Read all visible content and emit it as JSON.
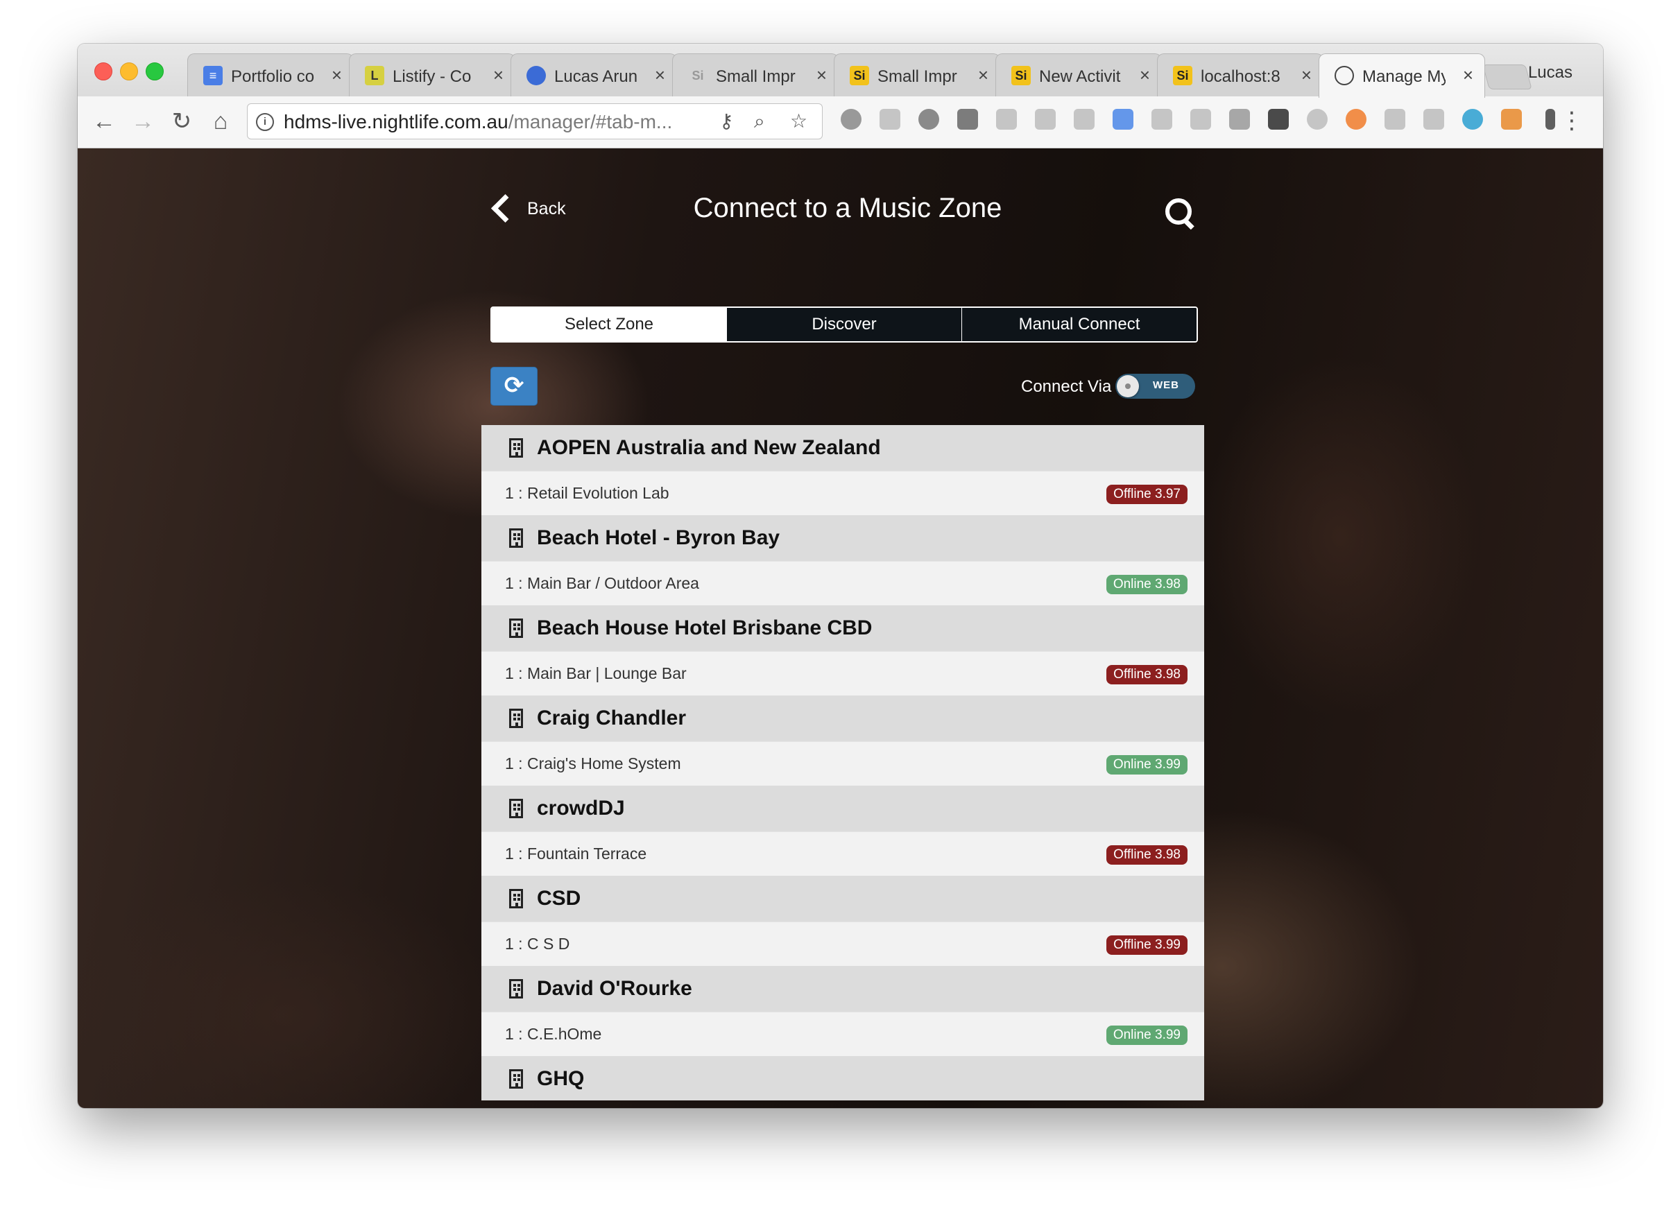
{
  "browser": {
    "tabs": [
      {
        "title": "Portfolio co",
        "favicon": "google-docs-icon",
        "active": false
      },
      {
        "title": "Listify - Co",
        "favicon": "listify-icon",
        "active": false
      },
      {
        "title": "Lucas Arun",
        "favicon": "profile-icon",
        "active": false
      },
      {
        "title": "Small Impr",
        "favicon": "si-icon",
        "active": false
      },
      {
        "title": "Small Impr",
        "favicon": "si-icon",
        "active": false
      },
      {
        "title": "New Activit",
        "favicon": "si-icon",
        "active": false
      },
      {
        "title": "localhost:8",
        "favicon": "si-icon",
        "active": false
      },
      {
        "title": "Manage My",
        "favicon": "globe-icon",
        "active": true
      }
    ],
    "profile_name": "Lucas",
    "url_host": "hdms-live.nightlife.com.au",
    "url_path": "/manager/#tab-m..."
  },
  "page": {
    "back_label": "Back",
    "title": "Connect to a Music Zone",
    "tabs": [
      {
        "label": "Select Zone",
        "active": true
      },
      {
        "label": "Discover",
        "active": false
      },
      {
        "label": "Manual Connect",
        "active": false
      }
    ],
    "connect_via_label": "Connect Via",
    "toggle_label": "WEB"
  },
  "zones": [
    {
      "name": "AOPEN Australia and New Zealand",
      "system": "1 : Retail Evolution Lab",
      "status": "Offline 3.97",
      "online": false
    },
    {
      "name": "Beach Hotel - Byron Bay",
      "system": "1 : Main Bar / Outdoor Area",
      "status": "Online 3.98",
      "online": true
    },
    {
      "name": "Beach House Hotel Brisbane CBD",
      "system": "1 : Main Bar | Lounge Bar",
      "status": "Offline 3.98",
      "online": false
    },
    {
      "name": "Craig Chandler",
      "system": "1 : Craig's Home System",
      "status": "Online 3.99",
      "online": true
    },
    {
      "name": "crowdDJ",
      "system": "1 : Fountain Terrace",
      "status": "Offline 3.98",
      "online": false
    },
    {
      "name": "CSD",
      "system": "1 : C S D",
      "status": "Offline 3.99",
      "online": false
    },
    {
      "name": "David O'Rourke",
      "system": "1 : C.E.hOme",
      "status": "Online 3.99",
      "online": true
    },
    {
      "name": "GHQ",
      "system": null,
      "status": null,
      "online": null
    }
  ],
  "colors": {
    "offline_badge": "#8c1f1f",
    "online_badge": "#5fa872",
    "refresh_button": "#3b82c4"
  }
}
